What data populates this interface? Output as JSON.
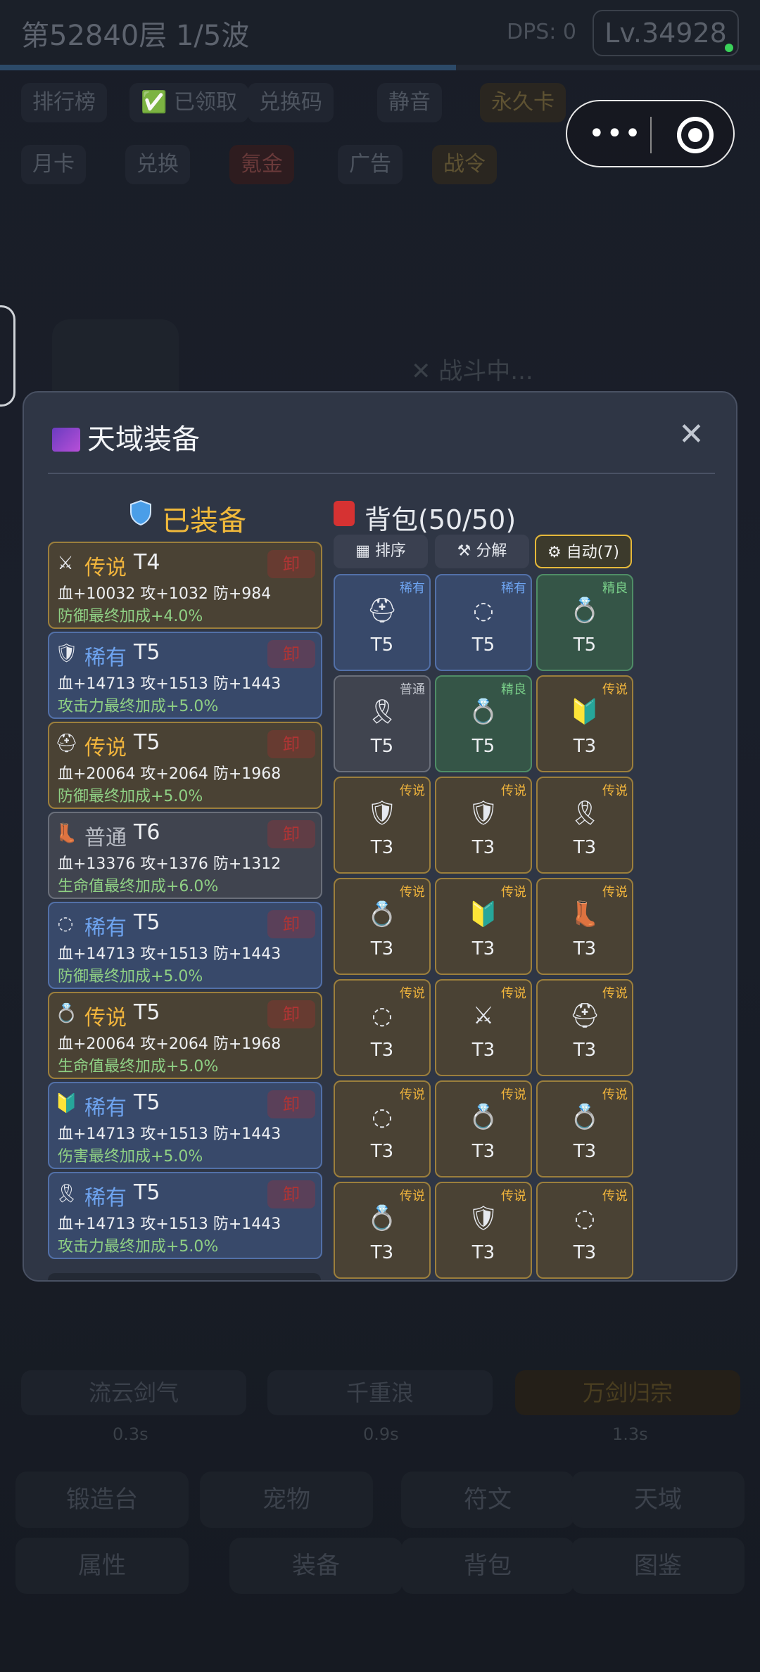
{
  "topbar": {
    "floor": "第52840层 1/5波",
    "dps": "DPS: 0",
    "level": "Lv.34928"
  },
  "chips_row1": [
    "排行榜",
    "✅ 已领取",
    "兑换码",
    "静音",
    "永久卡"
  ],
  "chips_row2": [
    "月卡",
    "兑换",
    "氪金",
    "广告",
    "战令"
  ],
  "background_text": {
    "fighting": "✕ 战斗中...",
    "skills": [
      "流云剑气",
      "千重浪",
      "万剑归宗"
    ],
    "skill_times": [
      "0.3s",
      "0.9s",
      "1.3s"
    ],
    "nav": [
      "锻造台",
      "宠物",
      "符文",
      "天域",
      "属性",
      "装备",
      "背包",
      "图鉴"
    ]
  },
  "modal": {
    "title": "天域装备",
    "equipped_title": "已装备",
    "bag_title": "背包(50/50)",
    "buttons": {
      "sort": "排序",
      "decompose": "分解",
      "auto": "自动(7)"
    },
    "unequip": "卸",
    "equipped": [
      {
        "icon": "sword-icon",
        "glyph": "⚔",
        "quality": "传说",
        "tier": "T4",
        "stats": "血+10032 攻+1032 防+984",
        "bonus": "防御最终加成+4.0%",
        "kind": "leg"
      },
      {
        "icon": "shield-icon",
        "glyph": "🛡",
        "quality": "稀有",
        "tier": "T5",
        "stats": "血+14713 攻+1513 防+1443",
        "bonus": "攻击力最终加成+5.0%",
        "kind": "rare"
      },
      {
        "icon": "helmet-icon",
        "glyph": "⛑",
        "quality": "传说",
        "tier": "T5",
        "stats": "血+20064 攻+2064 防+1968",
        "bonus": "防御最终加成+5.0%",
        "kind": "leg"
      },
      {
        "icon": "boots-icon",
        "glyph": "👢",
        "quality": "普通",
        "tier": "T6",
        "stats": "血+13376 攻+1376 防+1312",
        "bonus": "生命值最终加成+6.0%",
        "kind": "com"
      },
      {
        "icon": "necklace-icon",
        "glyph": "◌",
        "quality": "稀有",
        "tier": "T5",
        "stats": "血+14713 攻+1513 防+1443",
        "bonus": "防御最终加成+5.0%",
        "kind": "rare"
      },
      {
        "icon": "ring-icon",
        "glyph": "💍",
        "quality": "传说",
        "tier": "T5",
        "stats": "血+20064 攻+2064 防+1968",
        "bonus": "生命值最终加成+5.0%",
        "kind": "leg"
      },
      {
        "icon": "badge-icon",
        "glyph": "🔰",
        "quality": "稀有",
        "tier": "T5",
        "stats": "血+14713 攻+1513 防+1443",
        "bonus": "伤害最终加成+5.0%",
        "kind": "rare"
      },
      {
        "icon": "ribbon-icon",
        "glyph": "🎗",
        "quality": "稀有",
        "tier": "T5",
        "stats": "血+14713 攻+1513 防+1443",
        "bonus": "攻击力最终加成+5.0%",
        "kind": "rare"
      }
    ],
    "bag": [
      {
        "q": "稀有",
        "kind": "rare",
        "icon": "helmet-icon",
        "glyph": "⛑",
        "tier": "T5"
      },
      {
        "q": "稀有",
        "kind": "rare",
        "icon": "necklace-icon",
        "glyph": "◌",
        "tier": "T5"
      },
      {
        "q": "精良",
        "kind": "fine",
        "icon": "ring-icon",
        "glyph": "💍",
        "tier": "T5"
      },
      {
        "q": "普通",
        "kind": "com",
        "icon": "ribbon-icon",
        "glyph": "🎗",
        "tier": "T5"
      },
      {
        "q": "精良",
        "kind": "fine",
        "icon": "ring-icon",
        "glyph": "💍",
        "tier": "T5"
      },
      {
        "q": "传说",
        "kind": "leg",
        "icon": "badge-icon",
        "glyph": "🔰",
        "tier": "T3"
      },
      {
        "q": "传说",
        "kind": "leg",
        "icon": "shield-icon",
        "glyph": "🛡",
        "tier": "T3"
      },
      {
        "q": "传说",
        "kind": "leg",
        "icon": "shield-icon",
        "glyph": "🛡",
        "tier": "T3"
      },
      {
        "q": "传说",
        "kind": "leg",
        "icon": "ribbon-icon",
        "glyph": "🎗",
        "tier": "T3"
      },
      {
        "q": "传说",
        "kind": "leg",
        "icon": "ring-icon",
        "glyph": "💍",
        "tier": "T3"
      },
      {
        "q": "传说",
        "kind": "leg",
        "icon": "badge-icon",
        "glyph": "🔰",
        "tier": "T3"
      },
      {
        "q": "传说",
        "kind": "leg",
        "icon": "boots-icon",
        "glyph": "👢",
        "tier": "T3"
      },
      {
        "q": "传说",
        "kind": "leg",
        "icon": "necklace-icon",
        "glyph": "◌",
        "tier": "T3"
      },
      {
        "q": "传说",
        "kind": "leg",
        "icon": "sword-icon",
        "glyph": "⚔",
        "tier": "T3"
      },
      {
        "q": "传说",
        "kind": "leg",
        "icon": "helmet-icon",
        "glyph": "⛑",
        "tier": "T3"
      },
      {
        "q": "传说",
        "kind": "leg",
        "icon": "necklace-icon",
        "glyph": "◌",
        "tier": "T3"
      },
      {
        "q": "传说",
        "kind": "leg",
        "icon": "ring-icon",
        "glyph": "💍",
        "tier": "T3"
      },
      {
        "q": "传说",
        "kind": "leg",
        "icon": "ring-icon",
        "glyph": "💍",
        "tier": "T3"
      },
      {
        "q": "传说",
        "kind": "leg",
        "icon": "ring-icon",
        "glyph": "💍",
        "tier": "T3"
      },
      {
        "q": "传说",
        "kind": "leg",
        "icon": "shield-icon",
        "glyph": "🛡",
        "tier": "T3"
      },
      {
        "q": "传说",
        "kind": "leg",
        "icon": "necklace-icon",
        "glyph": "◌",
        "tier": "T3"
      }
    ]
  }
}
